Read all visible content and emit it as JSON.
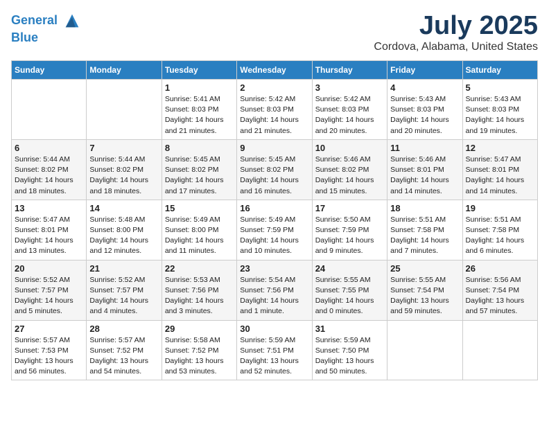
{
  "logo": {
    "line1": "General",
    "line2": "Blue"
  },
  "title": "July 2025",
  "subtitle": "Cordova, Alabama, United States",
  "days_header": [
    "Sunday",
    "Monday",
    "Tuesday",
    "Wednesday",
    "Thursday",
    "Friday",
    "Saturday"
  ],
  "weeks": [
    [
      {
        "day": "",
        "info": ""
      },
      {
        "day": "",
        "info": ""
      },
      {
        "day": "1",
        "info": "Sunrise: 5:41 AM\nSunset: 8:03 PM\nDaylight: 14 hours and 21 minutes."
      },
      {
        "day": "2",
        "info": "Sunrise: 5:42 AM\nSunset: 8:03 PM\nDaylight: 14 hours and 21 minutes."
      },
      {
        "day": "3",
        "info": "Sunrise: 5:42 AM\nSunset: 8:03 PM\nDaylight: 14 hours and 20 minutes."
      },
      {
        "day": "4",
        "info": "Sunrise: 5:43 AM\nSunset: 8:03 PM\nDaylight: 14 hours and 20 minutes."
      },
      {
        "day": "5",
        "info": "Sunrise: 5:43 AM\nSunset: 8:03 PM\nDaylight: 14 hours and 19 minutes."
      }
    ],
    [
      {
        "day": "6",
        "info": "Sunrise: 5:44 AM\nSunset: 8:02 PM\nDaylight: 14 hours and 18 minutes."
      },
      {
        "day": "7",
        "info": "Sunrise: 5:44 AM\nSunset: 8:02 PM\nDaylight: 14 hours and 18 minutes."
      },
      {
        "day": "8",
        "info": "Sunrise: 5:45 AM\nSunset: 8:02 PM\nDaylight: 14 hours and 17 minutes."
      },
      {
        "day": "9",
        "info": "Sunrise: 5:45 AM\nSunset: 8:02 PM\nDaylight: 14 hours and 16 minutes."
      },
      {
        "day": "10",
        "info": "Sunrise: 5:46 AM\nSunset: 8:02 PM\nDaylight: 14 hours and 15 minutes."
      },
      {
        "day": "11",
        "info": "Sunrise: 5:46 AM\nSunset: 8:01 PM\nDaylight: 14 hours and 14 minutes."
      },
      {
        "day": "12",
        "info": "Sunrise: 5:47 AM\nSunset: 8:01 PM\nDaylight: 14 hours and 14 minutes."
      }
    ],
    [
      {
        "day": "13",
        "info": "Sunrise: 5:47 AM\nSunset: 8:01 PM\nDaylight: 14 hours and 13 minutes."
      },
      {
        "day": "14",
        "info": "Sunrise: 5:48 AM\nSunset: 8:00 PM\nDaylight: 14 hours and 12 minutes."
      },
      {
        "day": "15",
        "info": "Sunrise: 5:49 AM\nSunset: 8:00 PM\nDaylight: 14 hours and 11 minutes."
      },
      {
        "day": "16",
        "info": "Sunrise: 5:49 AM\nSunset: 7:59 PM\nDaylight: 14 hours and 10 minutes."
      },
      {
        "day": "17",
        "info": "Sunrise: 5:50 AM\nSunset: 7:59 PM\nDaylight: 14 hours and 9 minutes."
      },
      {
        "day": "18",
        "info": "Sunrise: 5:51 AM\nSunset: 7:58 PM\nDaylight: 14 hours and 7 minutes."
      },
      {
        "day": "19",
        "info": "Sunrise: 5:51 AM\nSunset: 7:58 PM\nDaylight: 14 hours and 6 minutes."
      }
    ],
    [
      {
        "day": "20",
        "info": "Sunrise: 5:52 AM\nSunset: 7:57 PM\nDaylight: 14 hours and 5 minutes."
      },
      {
        "day": "21",
        "info": "Sunrise: 5:52 AM\nSunset: 7:57 PM\nDaylight: 14 hours and 4 minutes."
      },
      {
        "day": "22",
        "info": "Sunrise: 5:53 AM\nSunset: 7:56 PM\nDaylight: 14 hours and 3 minutes."
      },
      {
        "day": "23",
        "info": "Sunrise: 5:54 AM\nSunset: 7:56 PM\nDaylight: 14 hours and 1 minute."
      },
      {
        "day": "24",
        "info": "Sunrise: 5:55 AM\nSunset: 7:55 PM\nDaylight: 14 hours and 0 minutes."
      },
      {
        "day": "25",
        "info": "Sunrise: 5:55 AM\nSunset: 7:54 PM\nDaylight: 13 hours and 59 minutes."
      },
      {
        "day": "26",
        "info": "Sunrise: 5:56 AM\nSunset: 7:54 PM\nDaylight: 13 hours and 57 minutes."
      }
    ],
    [
      {
        "day": "27",
        "info": "Sunrise: 5:57 AM\nSunset: 7:53 PM\nDaylight: 13 hours and 56 minutes."
      },
      {
        "day": "28",
        "info": "Sunrise: 5:57 AM\nSunset: 7:52 PM\nDaylight: 13 hours and 54 minutes."
      },
      {
        "day": "29",
        "info": "Sunrise: 5:58 AM\nSunset: 7:52 PM\nDaylight: 13 hours and 53 minutes."
      },
      {
        "day": "30",
        "info": "Sunrise: 5:59 AM\nSunset: 7:51 PM\nDaylight: 13 hours and 52 minutes."
      },
      {
        "day": "31",
        "info": "Sunrise: 5:59 AM\nSunset: 7:50 PM\nDaylight: 13 hours and 50 minutes."
      },
      {
        "day": "",
        "info": ""
      },
      {
        "day": "",
        "info": ""
      }
    ]
  ]
}
